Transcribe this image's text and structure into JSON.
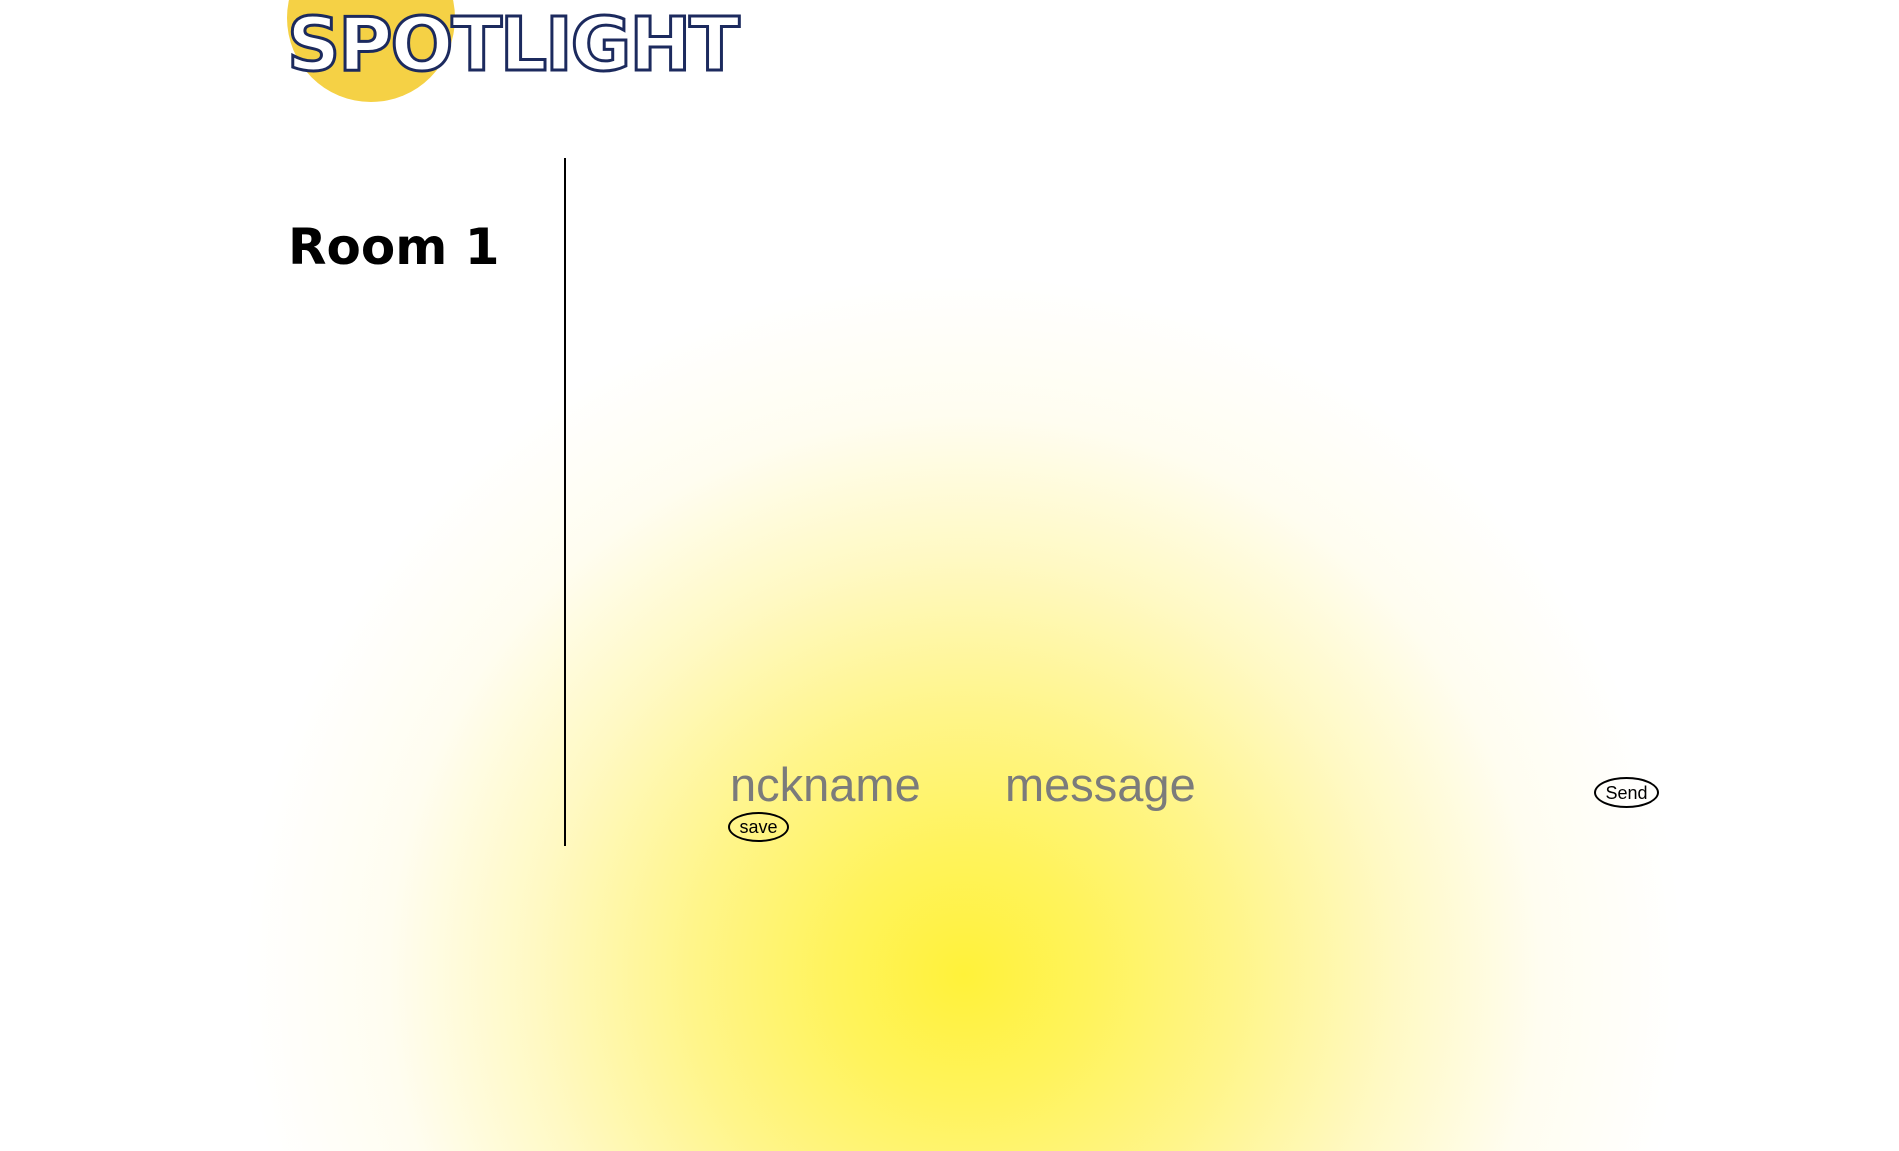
{
  "header": {
    "logo_text": "SPOTLIGHT"
  },
  "sidebar": {
    "room_title": "Room 1"
  },
  "composer": {
    "nickname_placeholder": "nckname",
    "message_placeholder": "message",
    "save_label": "save",
    "send_label": "Send"
  },
  "colors": {
    "logo_circle": "#f5d145",
    "logo_outline": "#1c2a5e",
    "spotlight_center": "#fff23a",
    "placeholder_text": "#7b7b7b"
  }
}
